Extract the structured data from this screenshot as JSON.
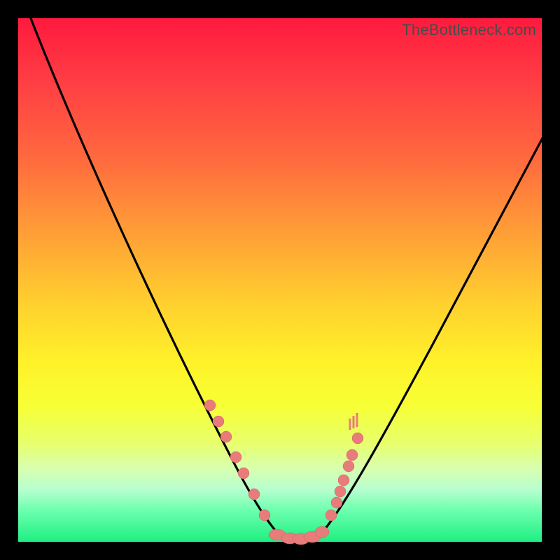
{
  "watermark": "TheBottleneck.com",
  "chart_data": {
    "type": "line",
    "title": "",
    "xlabel": "",
    "ylabel": "",
    "xlim": [
      0,
      100
    ],
    "ylim": [
      0,
      100
    ],
    "grid": false,
    "legend": false,
    "series": [
      {
        "name": "bottleneck-curve",
        "x": [
          2,
          6,
          10,
          14,
          18,
          22,
          26,
          30,
          34,
          38,
          42,
          46,
          48,
          50,
          52,
          54,
          56,
          58,
          62,
          66,
          70,
          74,
          78,
          82,
          86,
          90,
          94,
          98
        ],
        "y": [
          100,
          90,
          80,
          70,
          61,
          52,
          44,
          36,
          29,
          22,
          15,
          8,
          4,
          1,
          0,
          0,
          1,
          4,
          9,
          15,
          21,
          28,
          35,
          42,
          49,
          56,
          63,
          70
        ]
      }
    ],
    "markers": {
      "name": "highlighted-points",
      "comment": "salmon dots along curve near trough",
      "x_left": [
        36.5,
        38,
        39.5,
        41.5,
        43,
        45,
        47
      ],
      "y_left": [
        26,
        23,
        20,
        16,
        13,
        9,
        5
      ],
      "x_right": [
        58.5,
        60,
        60.5,
        61,
        62,
        62.5,
        63.5
      ],
      "y_right": [
        6,
        9,
        11,
        13,
        16,
        18,
        21
      ],
      "x_bottom": [
        49,
        51,
        53,
        55,
        56.5
      ],
      "y_bottom": [
        1,
        0.5,
        0.3,
        0.5,
        1.5
      ]
    },
    "gradient_stops": [
      {
        "pos": 0.0,
        "color": "#ff1a3e"
      },
      {
        "pos": 0.27,
        "color": "#ff6a3e"
      },
      {
        "pos": 0.55,
        "color": "#ffd22e"
      },
      {
        "pos": 0.74,
        "color": "#f7ff35"
      },
      {
        "pos": 0.9,
        "color": "#b7ffcf"
      },
      {
        "pos": 1.0,
        "color": "#1fef82"
      }
    ]
  }
}
